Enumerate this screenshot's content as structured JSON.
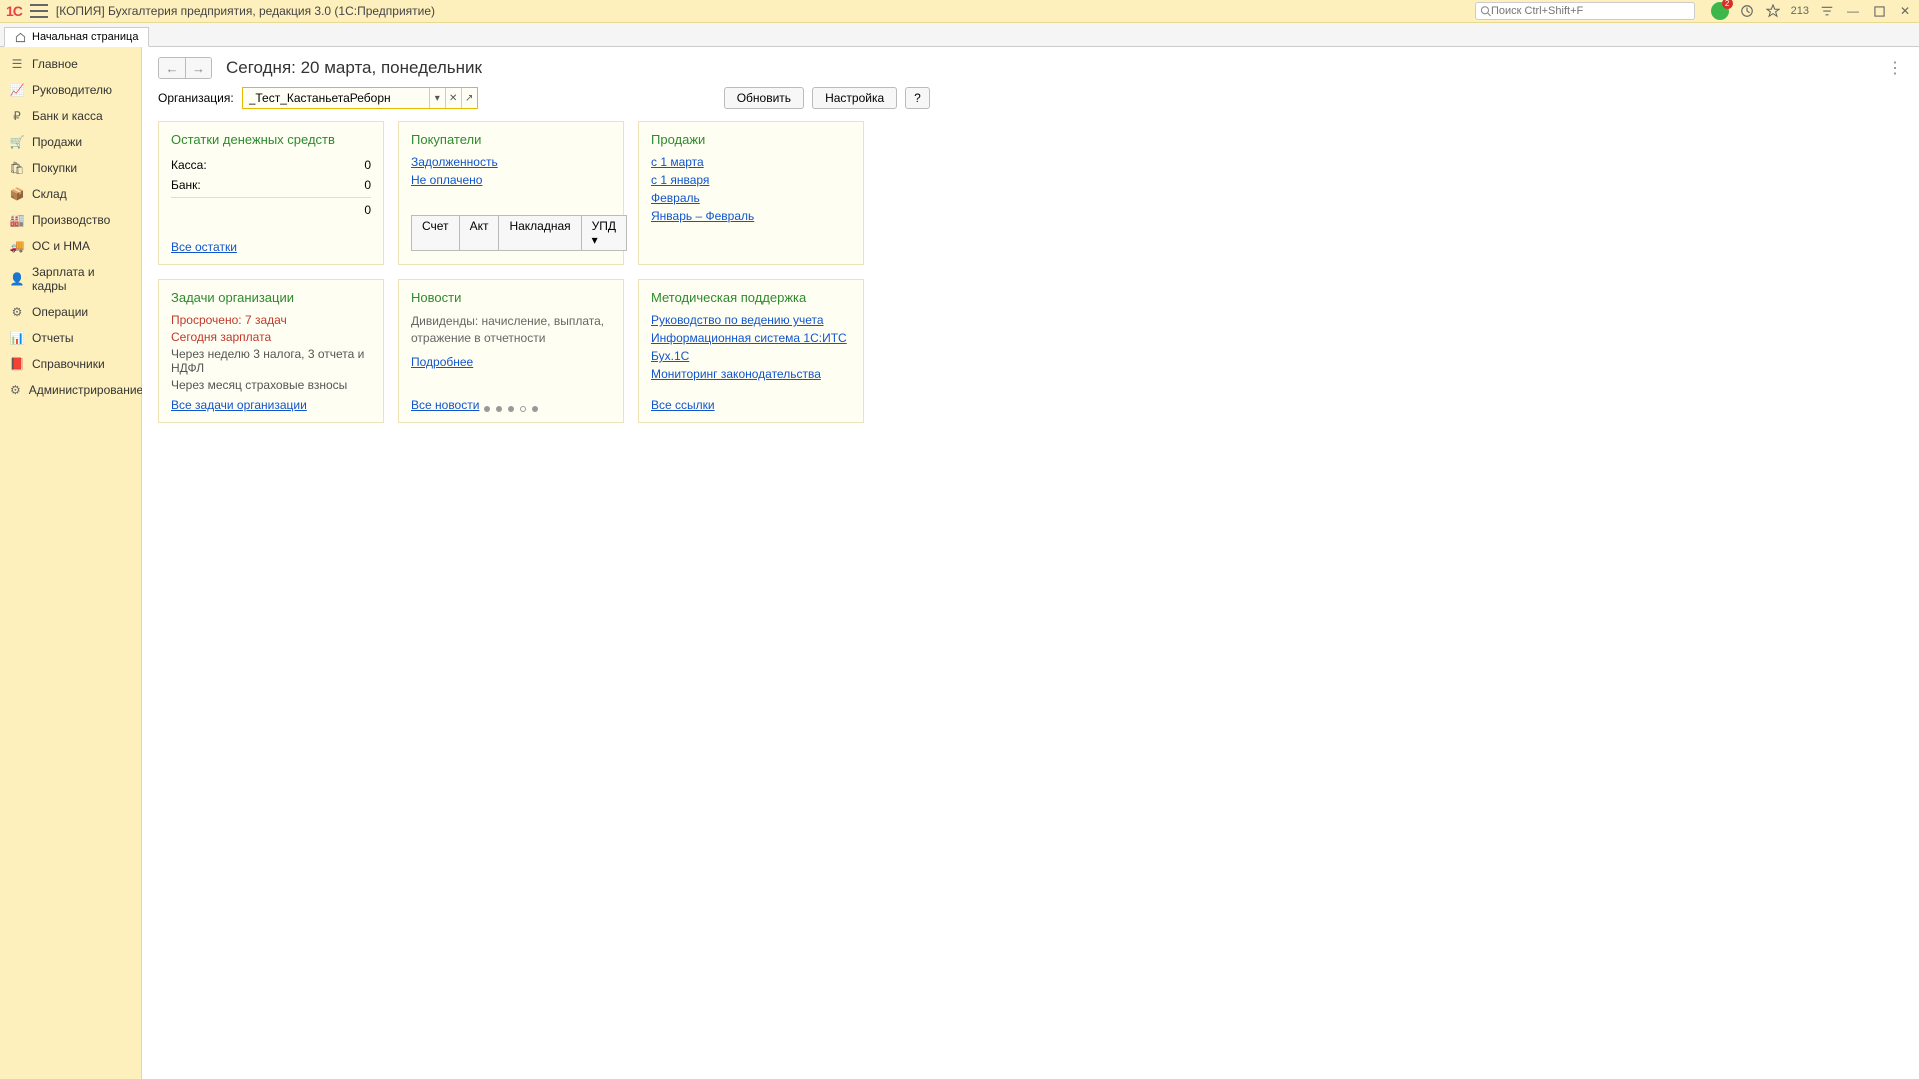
{
  "app": {
    "title": "[КОПИЯ] Бухгалтерия предприятия, редакция 3.0  (1С:Предприятие)",
    "logo": "1C",
    "search_placeholder": "Поиск Ctrl+Shift+F",
    "notif_count": "213"
  },
  "tab": {
    "label": "Начальная страница"
  },
  "sidebar": {
    "items": [
      {
        "label": "Главное"
      },
      {
        "label": "Руководителю"
      },
      {
        "label": "Банк и касса"
      },
      {
        "label": "Продажи"
      },
      {
        "label": "Покупки"
      },
      {
        "label": "Склад"
      },
      {
        "label": "Производство"
      },
      {
        "label": "ОС и НМА"
      },
      {
        "label": "Зарплата и кадры"
      },
      {
        "label": "Операции"
      },
      {
        "label": "Отчеты"
      },
      {
        "label": "Справочники"
      },
      {
        "label": "Администрирование"
      }
    ]
  },
  "page": {
    "title": "Сегодня: 20 марта, понедельник",
    "org_label": "Организация:",
    "org_value": "_Тест_КастаньетаРеборн",
    "btn_refresh": "Обновить",
    "btn_settings": "Настройка",
    "btn_help": "?"
  },
  "widgets": {
    "cash": {
      "title": "Остатки денежных средств",
      "row1_label": "Касса:",
      "row1_val": "0",
      "row2_label": "Банк:",
      "row2_val": "0",
      "total": "0",
      "link": "Все остатки"
    },
    "buyers": {
      "title": "Покупатели",
      "link1": "Задолженность",
      "link2": "Не оплачено",
      "btn1": "Счет",
      "btn2": "Акт",
      "btn3": "Накладная",
      "btn4": "УПД"
    },
    "sales": {
      "title": "Продажи",
      "link1": "с 1 марта",
      "link2": "с 1 января",
      "link3": "Февраль",
      "link4": "Январь – Февраль"
    },
    "tasks": {
      "title": "Задачи организации",
      "overdue": "Просрочено: 7 задач",
      "today": "Сегодня зарплата",
      "week": "Через неделю 3 налога, 3 отчета и НДФЛ",
      "month": "Через месяц страховые взносы",
      "link": "Все задачи организации"
    },
    "news": {
      "title": "Новости",
      "text": "Дивиденды: начисление, выплата, отражение в отчетности",
      "more": "Подробнее",
      "all": "Все новости"
    },
    "support": {
      "title": "Методическая поддержка",
      "link1": "Руководство по ведению учета",
      "link2": "Информационная система 1С:ИТС",
      "link3": "Бух.1С",
      "link4": "Мониторинг законодательства",
      "all": "Все ссылки"
    }
  }
}
